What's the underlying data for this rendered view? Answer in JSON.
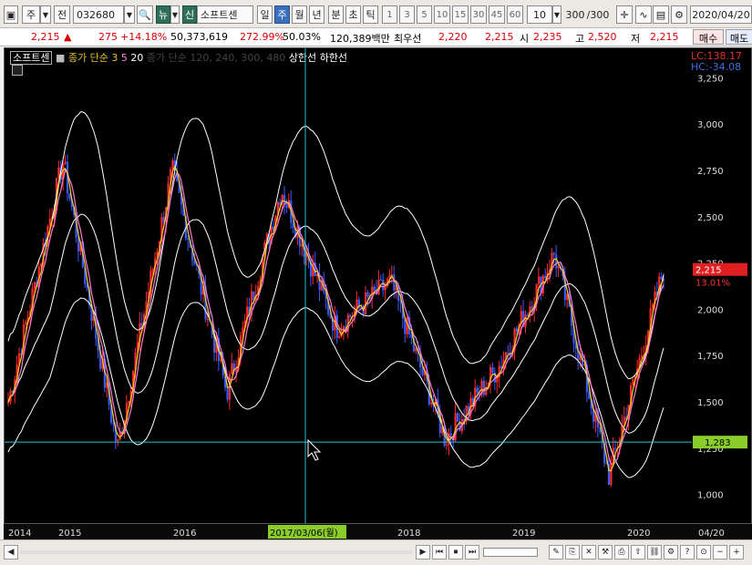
{
  "toolbar": {
    "period_prefix": "주",
    "prev_label": "전",
    "code": "032680",
    "news_label": "뉴",
    "sin_label": "신",
    "stock_name": "소프트센",
    "periods": [
      "일",
      "주",
      "월",
      "년"
    ],
    "minutes": [
      "분",
      "초",
      "틱"
    ],
    "numbers": [
      "1",
      "3",
      "5",
      "10",
      "15",
      "30",
      "45",
      "60"
    ],
    "count_select": "10",
    "page_count": "300",
    "page_total": "/300",
    "date": "2020/04/20"
  },
  "quote": {
    "price": "2,215",
    "change": "275",
    "change_pct": "+14.18%",
    "volume": "50,373,619",
    "vol_ratio": "272.99%",
    "rate": "50.03%",
    "amount": "120,389백만",
    "low_label": "최우선",
    "low_val": "2,220",
    "bid_val": "2,215",
    "open_label": "시",
    "open_val": "2,235",
    "high_label": "고",
    "high_val": "2,520",
    "low2_label": "저",
    "low2_val": "2,215",
    "buy_label": "매수",
    "sell_label": "매도"
  },
  "legend": {
    "name": "소프트센",
    "ma_label": "종가 단순",
    "ma_values": [
      "3",
      "5",
      "20"
    ],
    "ma_long": "종가 단순 120, 240, 300, 480",
    "upper": "상한선",
    "lower": "하한선"
  },
  "indicators": {
    "lc": "LC:138.17",
    "hc": "HC:-34.08",
    "price_tag": "2,215",
    "pct_tag": "13.01%",
    "cursor_tag": "1,283"
  },
  "time_axis": {
    "labels": [
      "2014",
      "2015",
      "2016",
      "2017/03/06(월)",
      "2018",
      "2019",
      "2020",
      "04/20"
    ]
  },
  "chart_data": {
    "type": "candlestick",
    "title": "",
    "ylim": [
      900,
      3350
    ],
    "y_ticks": [
      "3,250",
      "3,000",
      "2,750",
      "2,500",
      "2,250",
      "2,000",
      "1,750",
      "1,500",
      "1,250",
      "1,000"
    ],
    "x_labels": [
      "2014",
      "2015",
      "2016",
      "2017/03/06(월)",
      "2018",
      "2019",
      "2020",
      "04/20"
    ],
    "series": [
      {
        "name": "3",
        "values": [
          1400,
          2700,
          1200,
          2800,
          1400,
          2700,
          1800,
          2200,
          1300,
          1650,
          2350,
          1100,
          2215
        ]
      },
      {
        "name": "5",
        "values": [
          1420,
          2600,
          1250,
          2700,
          1450,
          2650,
          1850,
          2150,
          1320,
          1630,
          2300,
          1150,
          2200
        ]
      },
      {
        "name": "20",
        "values": [
          1450,
          2400,
          1350,
          2500,
          1550,
          2500,
          1900,
          2100,
          1400,
          1600,
          2200,
          1300,
          2100
        ]
      }
    ],
    "approx_closes": [
      1500,
      2800,
      1250,
      2750,
      1550,
      2650,
      1900,
      2150,
      1300,
      1700,
      2300,
      1100,
      2215
    ]
  },
  "statusbar": {
    "nav": [
      "◀",
      "▶",
      "⏮",
      "⏹",
      "⏭"
    ],
    "tools": [
      "−",
      "+",
      "◀"
    ]
  }
}
